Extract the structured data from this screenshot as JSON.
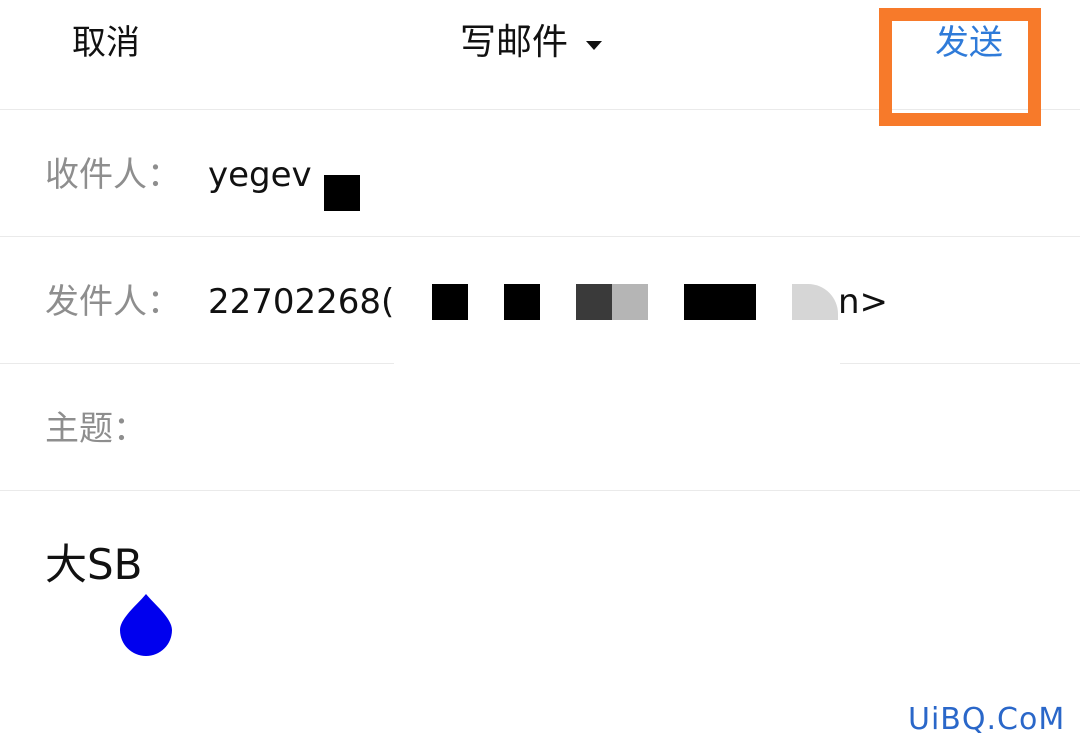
{
  "header": {
    "cancel_label": "取消",
    "title": "写邮件",
    "send_label": "发送"
  },
  "fields": {
    "to_label": "收件人：",
    "to_value": "yegev",
    "from_label": "发件人：",
    "from_value_start": "22702268(",
    "from_value_end": "n>",
    "subject_label": "主题：",
    "subject_value": ""
  },
  "body": {
    "text": "大SB"
  },
  "watermark": "UiBQ.CoM",
  "colors": {
    "accent": "#2f7bd9",
    "highlight": "#f77a2a",
    "cursor": "#0000ee",
    "label": "#8e8e8e"
  }
}
